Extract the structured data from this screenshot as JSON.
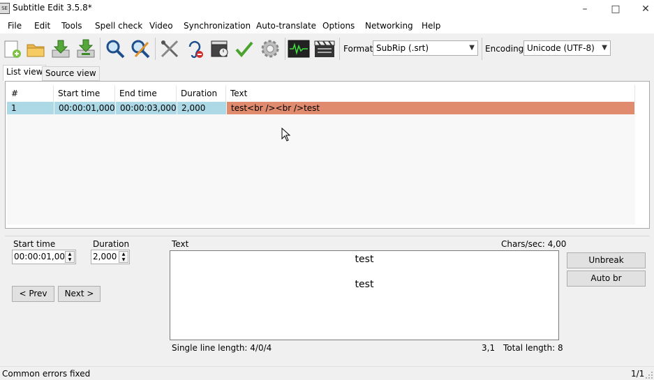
{
  "window": {
    "title": "Subtitle Edit 3.5.8*",
    "app_icon_text": "SE",
    "minimize": "–",
    "maximize": "□",
    "close": "✕"
  },
  "menu": {
    "items": [
      "File",
      "Edit",
      "Tools",
      "Spell check",
      "Video",
      "Synchronization",
      "Auto-translate",
      "Options",
      "Networking",
      "Help"
    ]
  },
  "toolbar": {
    "buttons": [
      "new-file-icon",
      "open-folder-icon",
      "save-icon",
      "save-as-icon",
      "find-icon",
      "find-replace-icon",
      "fix-errors-icon",
      "hearing-impaired-icon",
      "video-sync-icon",
      "spell-check-icon",
      "settings-gear-icon",
      "waveform-icon",
      "video-clapper-icon"
    ],
    "format_label": "Format",
    "format_value": "SubRip (.srt)",
    "encoding_label": "Encoding",
    "encoding_value": "Unicode (UTF-8)"
  },
  "tabs": {
    "list_view": "List view",
    "source_view": "Source view"
  },
  "list": {
    "columns": [
      "#",
      "Start time",
      "End time",
      "Duration",
      "Text"
    ],
    "rows": [
      {
        "num": "1",
        "start": "00:00:01,000",
        "end": "00:00:03,000",
        "duration": "2,000",
        "text": "test<br /><br />test"
      }
    ],
    "selected_color": "#add8e6",
    "text_highlight_color": "#e08a6e"
  },
  "edit": {
    "start_time_label": "Start time",
    "start_time_value": "00:00:01,000",
    "duration_label": "Duration",
    "duration_value": "2,000",
    "prev_button": "< Prev",
    "next_button": "Next >",
    "text_label": "Text",
    "chars_sec": "Chars/sec: 4,00",
    "text_line1": "test",
    "text_line2": "test",
    "single_line_length": "Single line length: 4/0/4",
    "cursor_pos": "3,1",
    "total_length": "Total length: 8",
    "unbreak_button": "Unbreak",
    "auto_br_button": "Auto br"
  },
  "status": {
    "message": "Common errors fixed",
    "position": "1/1"
  }
}
